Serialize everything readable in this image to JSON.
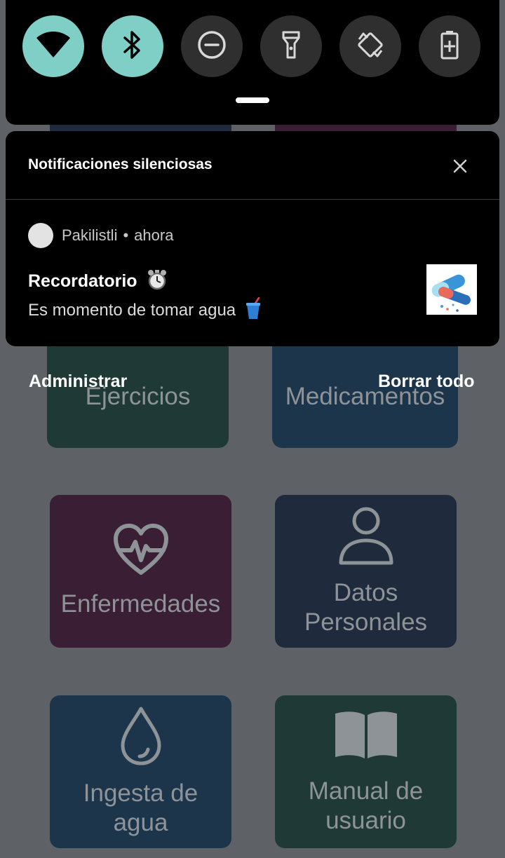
{
  "quick_settings": {
    "tiles": [
      {
        "icon": "wifi-icon",
        "state": "on"
      },
      {
        "icon": "bluetooth-icon",
        "state": "on"
      },
      {
        "icon": "do-not-disturb-icon",
        "state": "off"
      },
      {
        "icon": "flashlight-icon",
        "state": "off"
      },
      {
        "icon": "auto-rotate-icon",
        "state": "off"
      },
      {
        "icon": "battery-saver-icon",
        "state": "off"
      }
    ],
    "accent_color": "#7fcfc6"
  },
  "notifications": {
    "section_title": "Notificaciones silenciosas",
    "items": [
      {
        "app_name": "Pakilistli",
        "separator": "•",
        "time": "ahora",
        "title": "Recordatorio",
        "title_emoji": "alarm-clock-icon",
        "text": "Es momento de tomar agua",
        "text_emoji": "cup-with-straw-icon"
      }
    ]
  },
  "shade_actions": {
    "manage": "Administrar",
    "clear_all": "Borrar todo"
  },
  "app_tiles": {
    "exercises": "Ejercicios",
    "medications": "Medicamentos",
    "diseases": "Enfermedades",
    "personal_data": "Datos Personales",
    "water_intake": "Ingesta de agua",
    "user_manual": "Manual de usuario"
  }
}
